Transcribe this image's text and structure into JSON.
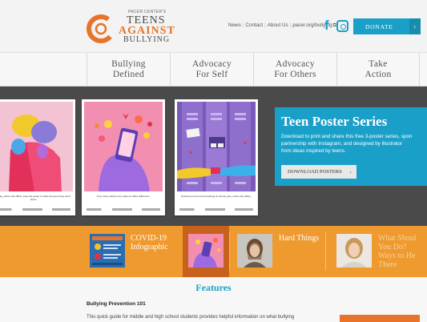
{
  "header": {
    "logo": {
      "small": "PACER CENTER'S",
      "line1": "TEENS",
      "line2": "AGAINST",
      "line3": "BULLYING"
    },
    "links": [
      "News",
      "Contact",
      "About Us",
      "pacer.org/bullying"
    ],
    "donate_label": "DONATE"
  },
  "nav": {
    "items": [
      {
        "line1": "Bullying",
        "line2": "Defined"
      },
      {
        "line1": "Advocacy",
        "line2": "For Self"
      },
      {
        "line1": "Advocacy",
        "line2": "For Others"
      },
      {
        "line1": "Take",
        "line2": "Action"
      }
    ]
  },
  "hero": {
    "posters": [
      {
        "caption": "...say, online and offline, have the power to show someone they aren't alone."
      },
      {
        "caption": "Your online actions can make an offline difference."
      },
      {
        "caption": "Kindness is free and something we all can give, online and offline."
      }
    ],
    "title": "Teen Poster Series",
    "description_lines": [
      "Download to print and share this free 3-poster series, spon",
      "partnership with Instagram, and designed by illustrator",
      "from ideas inspired by teens."
    ],
    "button_label": "DOWNLOAD POSTERS"
  },
  "strip": {
    "items": [
      {
        "title_lines": [
          "COVID-19",
          "Infographic"
        ]
      },
      {
        "title_lines": [
          "Hard Things"
        ]
      },
      {
        "title_lines": [
          "What Shoul",
          "You Do?",
          "Ways to He",
          "There"
        ]
      }
    ]
  },
  "features": {
    "heading": "Features",
    "subheading": "Bullying Prevention 101",
    "text": "This quick guide for middle and high school students provides helpful information on what bullying"
  },
  "colors": {
    "accent_blue": "#1aa0c8",
    "accent_orange": "#e8732a",
    "strip_orange": "#ef9a2f",
    "hero_dark": "#4a4a4a"
  }
}
